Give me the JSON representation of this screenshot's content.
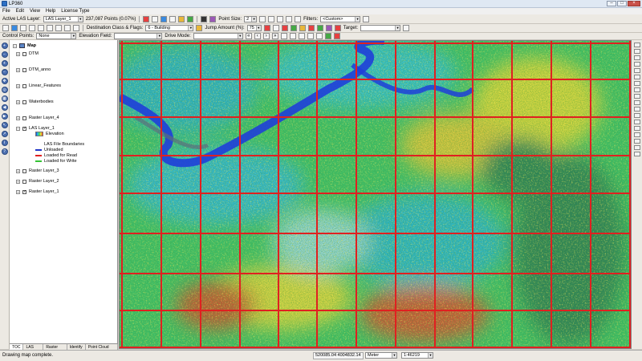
{
  "window": {
    "title": "LP360"
  },
  "menu": [
    "File",
    "Edit",
    "View",
    "Help",
    "License Type"
  ],
  "toolbar1": {
    "active_las_label": "Active LAS Layer:",
    "active_las_value": "LAS Layer_1",
    "points_info": "237,087 Points (0.07%)",
    "point_size_label": "Point Size:",
    "point_size_value": "2",
    "filters_label": "Filters:",
    "filters_value": "<Custom>"
  },
  "toolbar2": {
    "destination_label": "Destination Class & Flags:",
    "destination_value": "6 - Building",
    "jump_label": "Jump Amount (%):",
    "jump_value": "75",
    "target_label": "Target:"
  },
  "toolbar3": {
    "control_points_label": "Control Points:",
    "control_points_value": "None",
    "elevation_field_label": "Elevation Field:",
    "drive_mode_label": "Drive Mode:"
  },
  "toc": {
    "root": "Map",
    "layers": [
      {
        "name": "DTM",
        "checked": false
      },
      {
        "name": "DTM_anno",
        "checked": false
      },
      {
        "name": "Linear_Features",
        "checked": false
      },
      {
        "name": "Waterbodies",
        "checked": false
      },
      {
        "name": "Raster Layer_4",
        "checked": false
      },
      {
        "name": "LAS Layer_1",
        "checked": true
      },
      {
        "name": "Raster Layer_3",
        "checked": false
      },
      {
        "name": "Raster Layer_2",
        "checked": false
      },
      {
        "name": "Raster Layer_1",
        "checked": true
      }
    ],
    "las_children": {
      "elevation": "Elevation",
      "boundaries": "LAS File Boundaries",
      "unloaded": "Unloaded",
      "loaded_read": "Loaded for Read",
      "loaded_write": "Loaded for Write"
    },
    "tabs": [
      "TOC",
      "LAS Files",
      "Raster Files",
      "Identify",
      "Point Cloud Tasks"
    ]
  },
  "status": {
    "message": "Drawing map complete.",
    "coords": "520085.04  4004832.14",
    "units": "Meter",
    "scale": "1:46219"
  },
  "colors": {
    "grid": "#e01818",
    "boundary_unloaded": "#1f35c8",
    "boundary_read": "#e02020",
    "boundary_write": "#35c335",
    "river": "#1f3fd8"
  }
}
